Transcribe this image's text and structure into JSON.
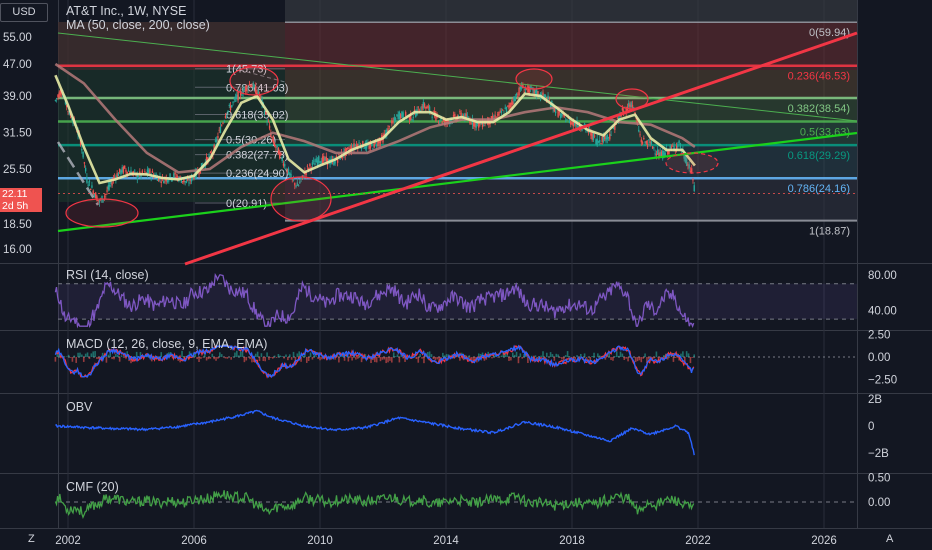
{
  "header": {
    "currency": "USD",
    "symbol_title": "AT&T Inc., 1W, NYSE"
  },
  "price_tag": {
    "price": "22.11",
    "countdown": "2d 5h"
  },
  "corner_buttons": {
    "left": "Z",
    "right": "A"
  },
  "colors": {
    "background": "#131722",
    "grid": "#2a2e39",
    "candle_up": "#26a69a",
    "candle_down": "#ef5350",
    "ma_fast": "#e8eba6",
    "ma_slow": "#b57979",
    "rsi": "#7e57c2",
    "macd": "#2962ff",
    "signal": "#f23645",
    "obv": "#2962ff",
    "cmf": "#43a047"
  },
  "chart_data": [
    {
      "type": "candlestick",
      "pane": "price",
      "title": "MA (50, close, 200, close)",
      "x_ticks": [
        "2002",
        "2006",
        "2010",
        "2014",
        "2018",
        "2022",
        "2026"
      ],
      "y_ticks": [
        "55.00",
        "47.00",
        "39.00",
        "31.50",
        "25.50",
        "18.50",
        "16.00"
      ],
      "y_scale": "log",
      "last_price": 22.11,
      "fib_levels": [
        {
          "label": "0(59.94)",
          "value": 59.94
        },
        {
          "label": "0.236(46.53)",
          "value": 46.53
        },
        {
          "label": "0.382(38.54)",
          "value": 38.54
        },
        {
          "label": "0.5(33.63)",
          "value": 33.63
        },
        {
          "label": "0.618(29.29)",
          "value": 29.29
        },
        {
          "label": "0.786(24.16)",
          "value": 24.16
        },
        {
          "label": "1(18.87)",
          "value": 18.87
        }
      ],
      "fib_levels_left": [
        {
          "label": "1(45.73)",
          "value": 45.73
        },
        {
          "label": "0.786(41.03)",
          "value": 41.03
        },
        {
          "label": "0.618(35.02)",
          "value": 35.02
        },
        {
          "label": "0.5(30.26)",
          "value": 30.26
        },
        {
          "label": "0.382(27.73)",
          "value": 27.73
        },
        {
          "label": "0.236(24.90)",
          "value": 24.9
        },
        {
          "label": "0(20.91)",
          "value": 20.91
        }
      ],
      "series_close": [
        [
          2001.6,
          38.0
        ],
        [
          2001.8,
          40.5
        ],
        [
          2002.0,
          36.0
        ],
        [
          2002.2,
          33.5
        ],
        [
          2002.4,
          30.0
        ],
        [
          2002.6,
          24.0
        ],
        [
          2002.8,
          22.5
        ],
        [
          2003.0,
          21.0
        ],
        [
          2003.2,
          22.0
        ],
        [
          2003.5,
          24.5
        ],
        [
          2003.8,
          25.5
        ],
        [
          2004.2,
          24.5
        ],
        [
          2004.6,
          25.0
        ],
        [
          2005.0,
          24.0
        ],
        [
          2005.4,
          24.5
        ],
        [
          2005.8,
          23.5
        ],
        [
          2006.2,
          25.5
        ],
        [
          2006.6,
          28.0
        ],
        [
          2007.0,
          35.0
        ],
        [
          2007.4,
          39.0
        ],
        [
          2007.8,
          42.0
        ],
        [
          2008.1,
          39.0
        ],
        [
          2008.5,
          30.0
        ],
        [
          2008.8,
          27.0
        ],
        [
          2009.1,
          24.0
        ],
        [
          2009.3,
          23.0
        ],
        [
          2009.6,
          25.5
        ],
        [
          2010.0,
          27.0
        ],
        [
          2010.4,
          26.5
        ],
        [
          2010.8,
          28.0
        ],
        [
          2011.2,
          29.5
        ],
        [
          2011.6,
          29.0
        ],
        [
          2012.0,
          30.5
        ],
        [
          2012.5,
          35.0
        ],
        [
          2012.9,
          34.5
        ],
        [
          2013.3,
          37.0
        ],
        [
          2013.7,
          34.5
        ],
        [
          2014.0,
          33.5
        ],
        [
          2014.5,
          35.0
        ],
        [
          2015.0,
          33.0
        ],
        [
          2015.5,
          34.0
        ],
        [
          2016.0,
          36.5
        ],
        [
          2016.4,
          41.0
        ],
        [
          2016.8,
          40.0
        ],
        [
          2017.2,
          38.5
        ],
        [
          2017.6,
          35.0
        ],
        [
          2018.0,
          33.5
        ],
        [
          2018.4,
          32.5
        ],
        [
          2018.8,
          30.0
        ],
        [
          2019.2,
          31.0
        ],
        [
          2019.6,
          35.5
        ],
        [
          2019.9,
          37.5
        ],
        [
          2020.2,
          30.0
        ],
        [
          2020.5,
          29.5
        ],
        [
          2020.8,
          27.5
        ],
        [
          2021.1,
          28.5
        ],
        [
          2021.4,
          29.5
        ],
        [
          2021.6,
          27.0
        ],
        [
          2021.8,
          25.0
        ],
        [
          2021.9,
          22.11
        ]
      ],
      "series_ma50": [
        [
          2001.6,
          44.0
        ],
        [
          2002.0,
          37.0
        ],
        [
          2002.5,
          29.0
        ],
        [
          2003.0,
          23.5
        ],
        [
          2003.5,
          24.0
        ],
        [
          2004.0,
          24.8
        ],
        [
          2004.5,
          24.7
        ],
        [
          2005.0,
          24.2
        ],
        [
          2005.5,
          24.0
        ],
        [
          2006.0,
          24.5
        ],
        [
          2006.5,
          27.0
        ],
        [
          2007.0,
          32.0
        ],
        [
          2007.5,
          37.5
        ],
        [
          2008.0,
          39.0
        ],
        [
          2008.5,
          34.0
        ],
        [
          2009.0,
          27.0
        ],
        [
          2009.5,
          25.0
        ],
        [
          2010.0,
          26.0
        ],
        [
          2010.5,
          27.0
        ],
        [
          2011.0,
          28.5
        ],
        [
          2011.5,
          29.5
        ],
        [
          2012.0,
          30.5
        ],
        [
          2012.5,
          33.5
        ],
        [
          2013.0,
          35.5
        ],
        [
          2013.5,
          35.5
        ],
        [
          2014.0,
          34.0
        ],
        [
          2014.5,
          34.5
        ],
        [
          2015.0,
          33.5
        ],
        [
          2015.5,
          33.5
        ],
        [
          2016.0,
          35.5
        ],
        [
          2016.5,
          39.5
        ],
        [
          2017.0,
          39.0
        ],
        [
          2017.5,
          36.5
        ],
        [
          2018.0,
          34.0
        ],
        [
          2018.5,
          32.0
        ],
        [
          2019.0,
          31.0
        ],
        [
          2019.5,
          34.0
        ],
        [
          2020.0,
          35.0
        ],
        [
          2020.5,
          30.5
        ],
        [
          2021.0,
          28.5
        ],
        [
          2021.5,
          28.5
        ],
        [
          2021.9,
          26.0
        ]
      ],
      "series_ma200": [
        [
          2001.6,
          47.0
        ],
        [
          2002.5,
          42.0
        ],
        [
          2003.5,
          34.0
        ],
        [
          2004.5,
          28.0
        ],
        [
          2005.5,
          25.0
        ],
        [
          2006.5,
          25.5
        ],
        [
          2007.5,
          29.0
        ],
        [
          2008.5,
          31.5
        ],
        [
          2009.5,
          30.0
        ],
        [
          2010.5,
          28.0
        ],
        [
          2011.5,
          28.0
        ],
        [
          2012.5,
          30.0
        ],
        [
          2013.5,
          32.5
        ],
        [
          2014.5,
          34.0
        ],
        [
          2015.5,
          34.0
        ],
        [
          2016.5,
          35.5
        ],
        [
          2017.5,
          36.5
        ],
        [
          2018.5,
          35.5
        ],
        [
          2019.5,
          33.5
        ],
        [
          2020.5,
          33.0
        ],
        [
          2021.5,
          30.5
        ],
        [
          2021.9,
          29.0
        ]
      ]
    },
    {
      "type": "line",
      "pane": "rsi",
      "title": "RSI (14, close)",
      "y_ticks": [
        "80.00",
        "40.00"
      ],
      "bands": [
        30,
        70
      ],
      "last": 25
    },
    {
      "type": "line",
      "pane": "macd",
      "title": "MACD (12, 26, close, 9, EMA, EMA)",
      "y_ticks": [
        "2.50",
        "0.00",
        "−2.50"
      ]
    },
    {
      "type": "line",
      "pane": "obv",
      "title": "OBV",
      "y_ticks": [
        "2B",
        "0",
        "−2B"
      ],
      "series": [
        [
          2001.6,
          0.0
        ],
        [
          2002.5,
          -0.1
        ],
        [
          2003.5,
          -0.2
        ],
        [
          2004.5,
          -0.25
        ],
        [
          2005.5,
          -0.05
        ],
        [
          2006.5,
          0.3
        ],
        [
          2007.5,
          0.8
        ],
        [
          2008.0,
          1.1
        ],
        [
          2008.5,
          0.6
        ],
        [
          2009.5,
          0.0
        ],
        [
          2010.5,
          -0.3
        ],
        [
          2011.5,
          -0.1
        ],
        [
          2012.5,
          0.6
        ],
        [
          2013.5,
          0.2
        ],
        [
          2014.5,
          -0.2
        ],
        [
          2015.5,
          -0.5
        ],
        [
          2016.5,
          0.3
        ],
        [
          2017.5,
          -0.1
        ],
        [
          2018.5,
          -0.7
        ],
        [
          2019.2,
          -1.1
        ],
        [
          2019.9,
          -0.2
        ],
        [
          2020.5,
          -0.6
        ],
        [
          2021.3,
          0.0
        ],
        [
          2021.7,
          -0.5
        ],
        [
          2021.9,
          -2.3
        ]
      ]
    },
    {
      "type": "line",
      "pane": "cmf",
      "title": "CMF (20)",
      "y_ticks": [
        "0.50",
        "0.00"
      ]
    }
  ]
}
